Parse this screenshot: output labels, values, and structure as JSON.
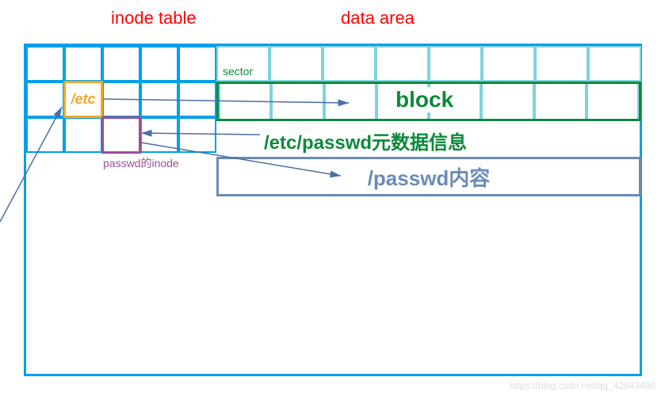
{
  "headings": {
    "inode_table": "inode table",
    "data_area": "data area"
  },
  "labels": {
    "etc": "/etc",
    "passwd_inode": "passwd的inode",
    "sector": "sector",
    "block": "block",
    "etc_passwd_meta": "/etc/passwd元数据信息",
    "passwd_content": "/passwd内容"
  },
  "grid": {
    "inode_rows": 3,
    "inode_cols": 5,
    "sector_cols": 8,
    "block_cols": 8
  },
  "colors": {
    "frame": "#00a0e9",
    "heading": "#ff0000",
    "green": "#0b8a3a",
    "orange": "#f5a623",
    "purple": "#9b4f96",
    "blue_gray": "#6a8bb8",
    "light_cyan": "#7dd3e0"
  },
  "watermark": "https://blog.csdn.net/qq_42643496"
}
